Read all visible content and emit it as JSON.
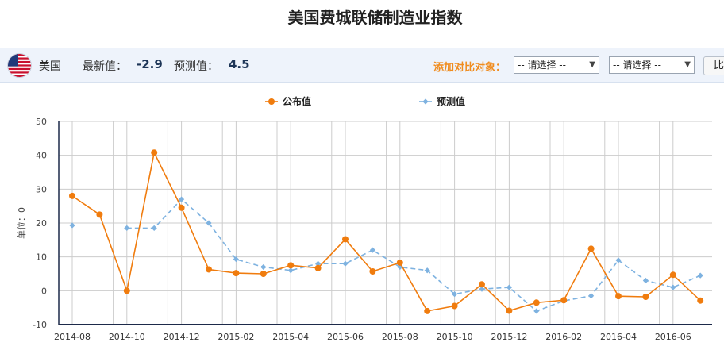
{
  "page": {
    "title": "美国费城联储制造业指数"
  },
  "info_bar": {
    "country": "美国",
    "latest_label": "最新值：",
    "latest_value": "-2.9",
    "forecast_label": "预测值：",
    "forecast_value": "4.5",
    "compare_label": "添加对比对象：",
    "select1": "-- 请选择 --",
    "select2": "-- 请选择 --",
    "compare_button": "比",
    "flag_icon": "us-flag-icon"
  },
  "colors": {
    "published": "#f07c0e",
    "forecast": "#7eb2e0",
    "accent": "#f08c1e",
    "axis": "#1d2a4a",
    "grid": "#cccccc"
  },
  "chart_data": {
    "type": "line",
    "legend": {
      "position": "top-center"
    },
    "ylabel": "单位：0",
    "ylim": [
      -10,
      50
    ],
    "yticks": [
      -10,
      0,
      10,
      20,
      30,
      40,
      50
    ],
    "grid": true,
    "categories": [
      "2014-08",
      "2014-09",
      "2014-10",
      "2014-11",
      "2014-12",
      "2015-01",
      "2015-02",
      "2015-03",
      "2015-04",
      "2015-05",
      "2015-06",
      "2015-07",
      "2015-08",
      "2015-09",
      "2015-10",
      "2015-11",
      "2015-12",
      "2016-01",
      "2016-02",
      "2016-03",
      "2016-04",
      "2016-05",
      "2016-06",
      "2016-07"
    ],
    "xtick_labels": [
      "2014-08",
      "2014-10",
      "2014-12",
      "2015-02",
      "2015-04",
      "2015-06",
      "2015-08",
      "2015-10",
      "2015-12",
      "2016-02",
      "2016-04",
      "2016-06"
    ],
    "series": [
      {
        "name": "公布值",
        "style": "solid-circle",
        "values": [
          28.0,
          22.5,
          0.0,
          40.8,
          24.5,
          6.3,
          5.2,
          5.0,
          7.5,
          6.7,
          15.2,
          5.7,
          8.3,
          -6.0,
          -4.5,
          1.9,
          -5.9,
          -3.5,
          -2.8,
          12.4,
          -1.6,
          -1.8,
          4.7,
          -2.9
        ]
      },
      {
        "name": "预测值",
        "style": "dashed-diamond",
        "values": [
          19.3,
          null,
          18.5,
          18.5,
          27.0,
          20.0,
          9.3,
          7.0,
          6.0,
          8.0,
          8.0,
          12.0,
          7.0,
          6.0,
          -1.0,
          0.5,
          1.0,
          -6.0,
          -3.0,
          -1.5,
          9.0,
          3.0,
          1.0,
          4.5
        ]
      }
    ]
  }
}
